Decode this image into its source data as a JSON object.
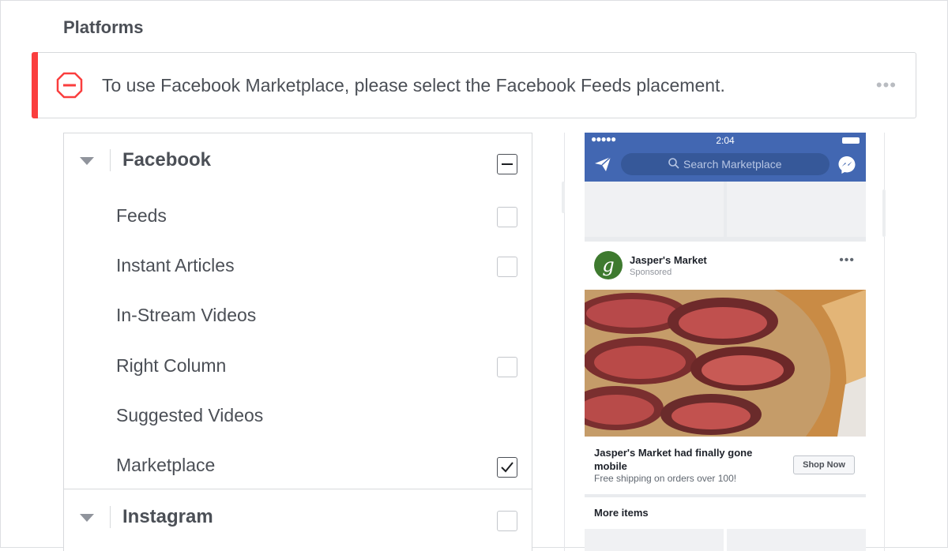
{
  "section": {
    "title": "Platforms"
  },
  "banner": {
    "message": "To use Facebook Marketplace, please select the Facebook Feeds placement.",
    "more_label": "•••",
    "icon": "stop-icon",
    "accent_color": "#fa3e3e"
  },
  "placements": {
    "facebook": {
      "label": "Facebook",
      "state": "indeterminate",
      "items": [
        {
          "label": "Feeds",
          "checked": false,
          "has_checkbox": true
        },
        {
          "label": "Instant Articles",
          "checked": false,
          "has_checkbox": true
        },
        {
          "label": "In-Stream Videos",
          "checked": false,
          "has_checkbox": false
        },
        {
          "label": "Right Column",
          "checked": false,
          "has_checkbox": true
        },
        {
          "label": "Suggested Videos",
          "checked": false,
          "has_checkbox": false
        },
        {
          "label": "Marketplace",
          "checked": true,
          "has_checkbox": true
        }
      ]
    },
    "instagram": {
      "label": "Instagram",
      "checked": false
    }
  },
  "preview": {
    "status": {
      "signal": "●●●●●",
      "time": "2:04"
    },
    "search_placeholder": "Search Marketplace",
    "brand_color": "#4267b2",
    "ad": {
      "advertiser": "Jasper's Market",
      "avatar_letter": "g",
      "sponsored": "Sponsored",
      "more_label": "•••",
      "headline": "Jasper's Market had finally gone mobile",
      "description": "Free shipping on orders over 100!",
      "cta": "Shop Now"
    },
    "more_items_label": "More items"
  }
}
